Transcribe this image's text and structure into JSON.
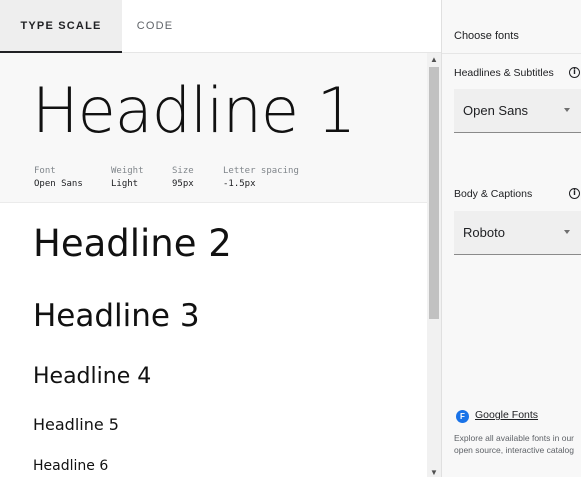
{
  "tabs": [
    {
      "label": "TYPE SCALE",
      "active": true
    },
    {
      "label": "CODE",
      "active": false
    }
  ],
  "type_scale": {
    "headline1": {
      "text": "Headline 1",
      "meta": {
        "font_label": "Font",
        "font_value": "Open Sans",
        "weight_label": "Weight",
        "weight_value": "Light",
        "size_label": "Size",
        "size_value": "95px",
        "spacing_label": "Letter spacing",
        "spacing_value": "-1.5px"
      }
    },
    "headline2": "Headline 2",
    "headline3": "Headline 3",
    "headline4": "Headline 4",
    "headline5": "Headline 5",
    "headline6": "Headline 6"
  },
  "right_panel": {
    "title": "Choose fonts",
    "headlines": {
      "label": "Headlines & Subtitles",
      "selected": "Open Sans"
    },
    "body": {
      "label": "Body & Captions",
      "selected": "Roboto"
    },
    "google_fonts": {
      "logo_letter": "F",
      "link_text": "Google Fonts",
      "description": "Explore all available fonts in our open source, interactive catalog"
    }
  },
  "icons": {
    "info": "info-icon",
    "scroll_up": "chevron-up-icon",
    "scroll_down": "chevron-down-icon",
    "dropdown": "caret-down-icon"
  },
  "colors": {
    "accent": "#1a73e8",
    "text": "#202124",
    "muted": "#5f6368",
    "panel_bg": "#f8f8f8"
  }
}
